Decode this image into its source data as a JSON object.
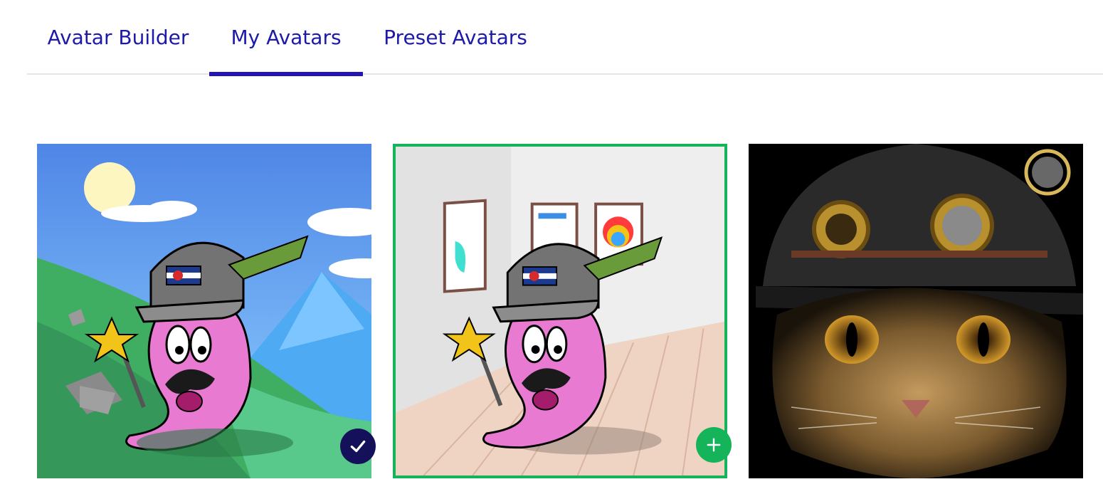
{
  "tabs": [
    {
      "label": "Avatar Builder",
      "active": false
    },
    {
      "label": "My Avatars",
      "active": true
    },
    {
      "label": "Preset Avatars",
      "active": false
    }
  ],
  "avatars": [
    {
      "scene": "outdoor-hills-chili-pepper",
      "state": "selected",
      "badge_icon": "check-icon"
    },
    {
      "scene": "indoor-room-chili-pepper",
      "state": "highlighted",
      "badge_icon": "plus-icon"
    },
    {
      "scene": "steampunk-cat",
      "state": "default"
    }
  ],
  "colors": {
    "tab_text": "#1e1aa8",
    "tab_underline": "#2514b4",
    "selected_badge": "#14105a",
    "add_badge": "#16b45a",
    "highlight_border": "#16b45a"
  }
}
